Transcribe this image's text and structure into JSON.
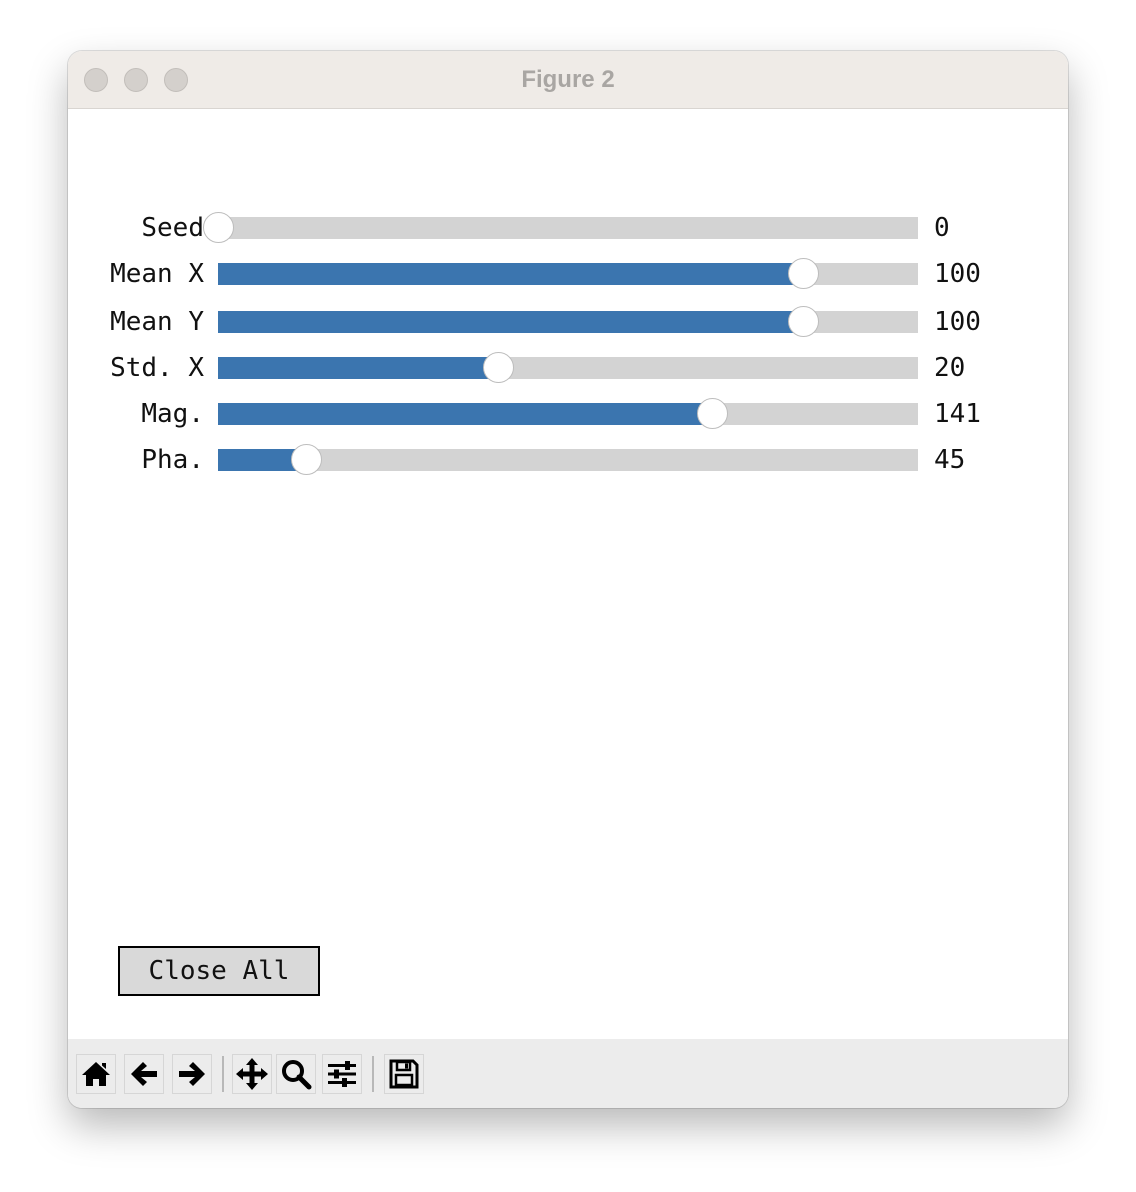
{
  "window": {
    "title": "Figure 2"
  },
  "sliders": [
    {
      "label": "Seed",
      "value_text": "0",
      "fraction": 0.0
    },
    {
      "label": "Mean X",
      "value_text": "100",
      "fraction": 0.835
    },
    {
      "label": "Mean Y",
      "value_text": "100",
      "fraction": 0.835
    },
    {
      "label": "Std. X",
      "value_text": "20",
      "fraction": 0.4
    },
    {
      "label": "Mag.",
      "value_text": "141",
      "fraction": 0.705
    },
    {
      "label": "Pha.",
      "value_text": "45",
      "fraction": 0.125
    }
  ],
  "buttons": {
    "close_all": "Close All"
  },
  "toolbar": {
    "icons": [
      "home-icon",
      "back-arrow-icon",
      "forward-arrow-icon",
      "pan-icon",
      "zoom-icon",
      "subplots-config-icon",
      "save-icon"
    ]
  },
  "colors": {
    "slider_fill": "#3b75af",
    "slider_track": "#d3d3d3",
    "titlebar": "#efebe7",
    "toolbar": "#ececec"
  }
}
